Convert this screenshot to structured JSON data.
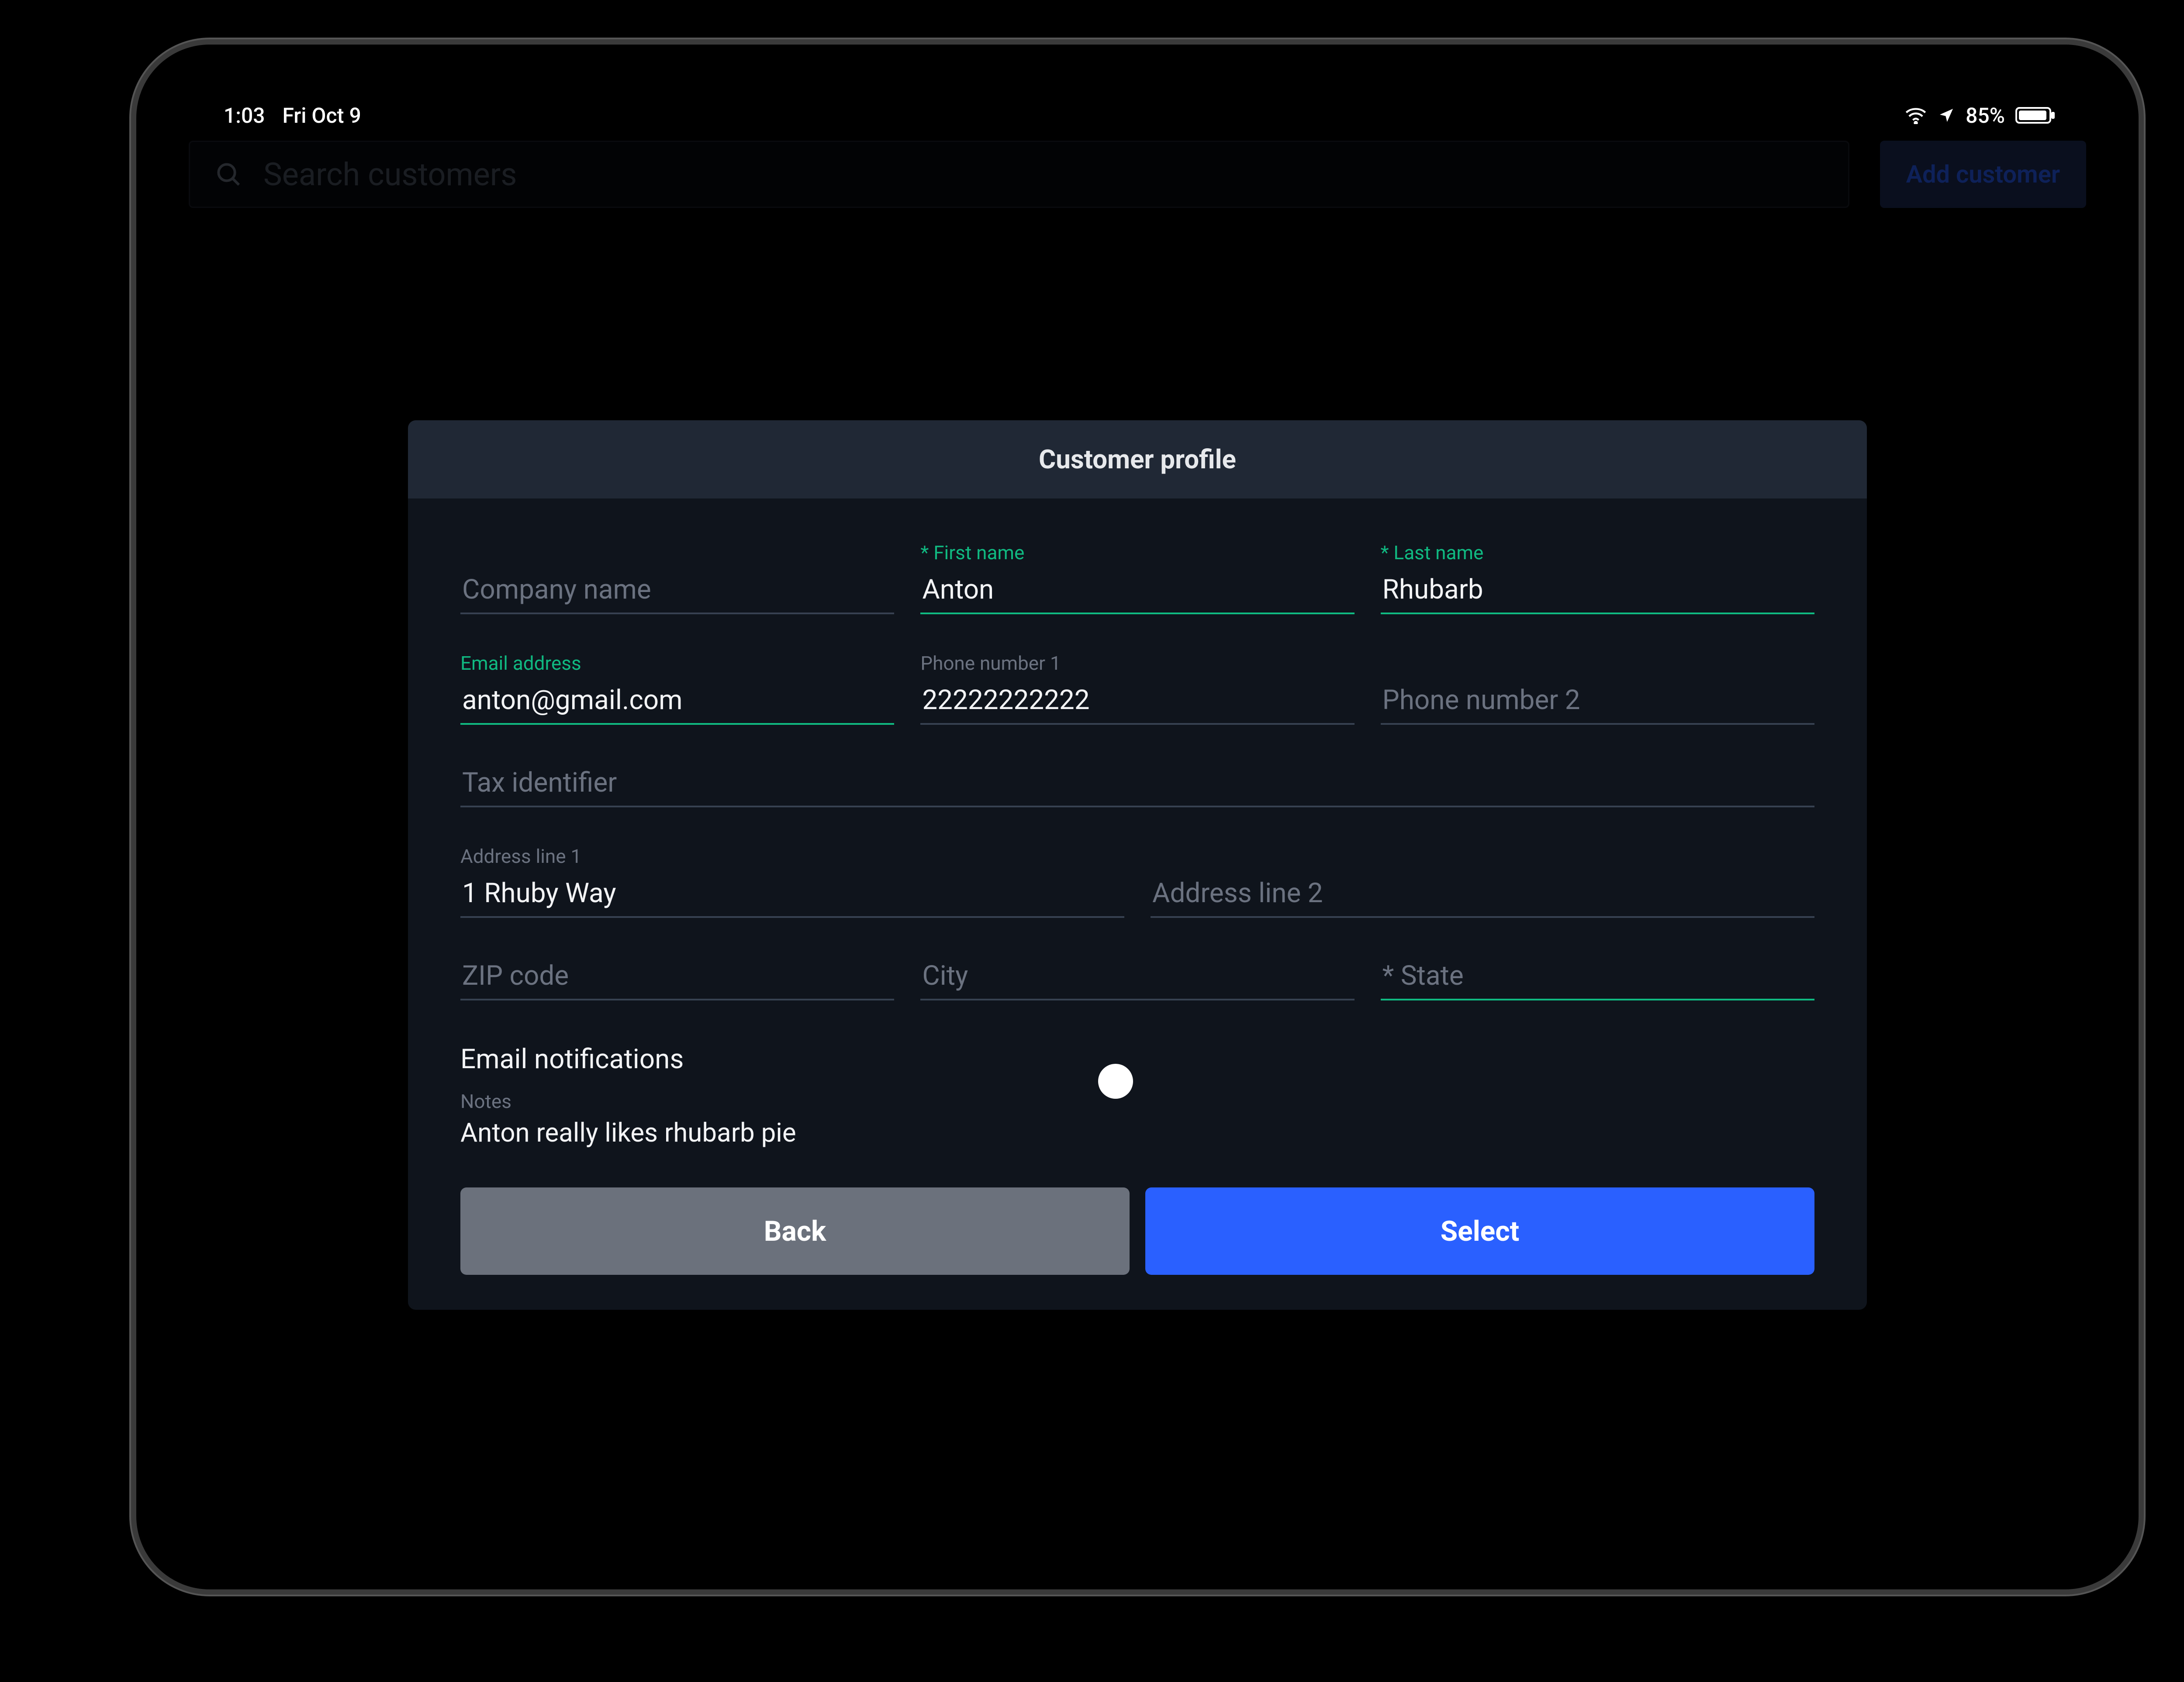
{
  "statusbar": {
    "time": "1:03",
    "date": "Fri Oct 9",
    "battery_pct": "85%"
  },
  "bg": {
    "search_placeholder": "Search customers",
    "add_customer_label": "Add customer"
  },
  "modal": {
    "title": "Customer profile",
    "fields": {
      "company_label": "Company name",
      "company_value": "",
      "first_name_label": "* First name",
      "first_name_value": "Anton",
      "last_name_label": "* Last name",
      "last_name_value": "Rhubarb",
      "email_label": "Email address",
      "email_value": "anton@gmail.com",
      "phone1_label": "Phone number 1",
      "phone1_value": "22222222222",
      "phone2_placeholder": "Phone number 2",
      "tax_placeholder": "Tax identifier",
      "addr1_label": "Address line 1",
      "addr1_value": "1 Rhuby Way",
      "addr2_placeholder": "Address line 2",
      "zip_placeholder": "ZIP code",
      "city_placeholder": "City",
      "state_placeholder": "* State"
    },
    "email_notifications_label": "Email notifications",
    "email_notifications_on": true,
    "notes_label": "Notes",
    "notes_value": "Anton really likes rhubarb pie",
    "back_label": "Back",
    "select_label": "Select"
  },
  "colors": {
    "accent_blue": "#2a60ff",
    "accent_green": "#10b981"
  }
}
